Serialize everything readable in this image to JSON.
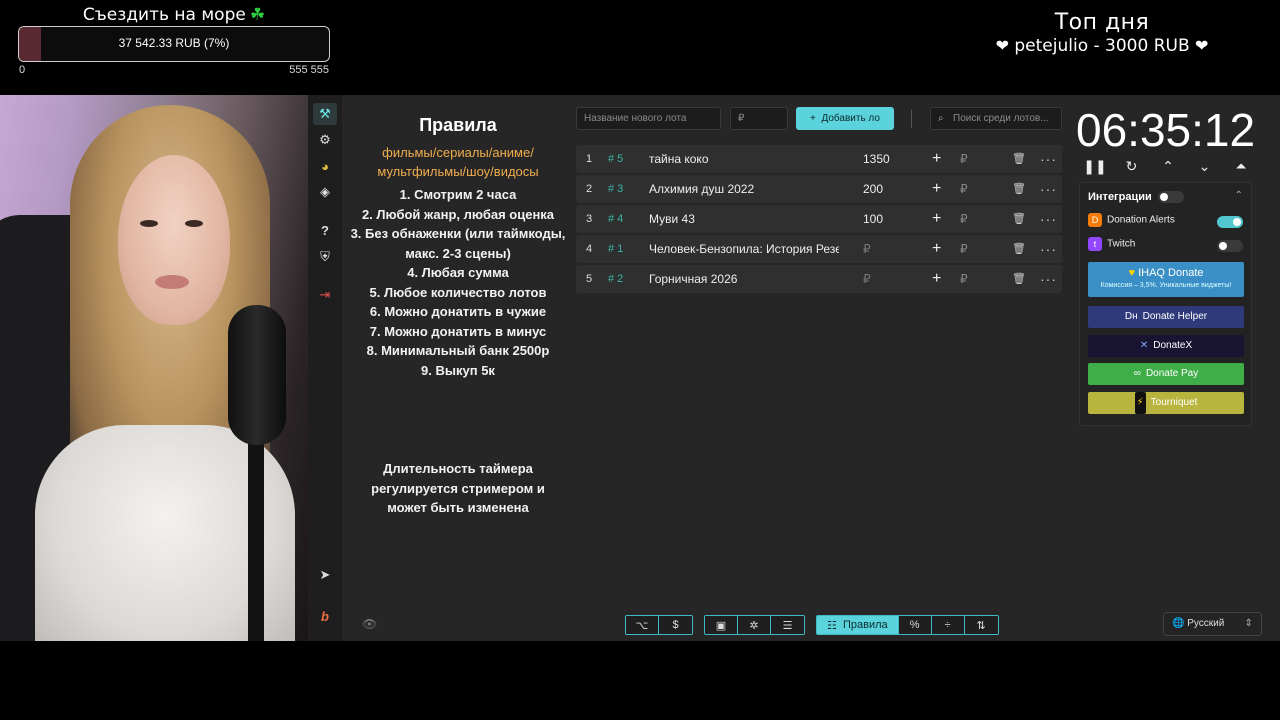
{
  "overlay": {
    "goal": {
      "title": "Съездить на море",
      "clover_icon": "☘",
      "amount_text": "37 542.33 RUB (7%)",
      "progress_fraction": 0.07,
      "min_label": "0",
      "max_label": "555 555"
    },
    "top_day": {
      "title": "Топ дня",
      "entry": "petejulio - 3000 RUB",
      "heart": "❤"
    }
  },
  "sidebar": {
    "items": [
      {
        "icon": "hammer-icon",
        "glyph": "⚒",
        "active": true
      },
      {
        "icon": "gear-icon",
        "glyph": "⚙"
      },
      {
        "icon": "pie-chart-icon",
        "glyph": "◕"
      },
      {
        "icon": "layers-icon",
        "glyph": "◈"
      },
      {
        "icon": "help-icon",
        "glyph": "?"
      },
      {
        "icon": "shield-icon",
        "glyph": "⛨"
      },
      {
        "icon": "logout-icon",
        "glyph": "⇥"
      },
      {
        "icon": "telegram-icon",
        "glyph": "➤"
      },
      {
        "icon": "boosty-icon",
        "glyph": "b"
      }
    ]
  },
  "rules": {
    "title": "Правила",
    "genres": "фильмы/сериалы/аниме/ мультфильмы/шоу/видосы",
    "items": [
      "1. Смотрим 2 часа",
      "2. Любой жанр, любая оценка",
      "3. Без обнаженки (или таймкоды, макс. 2-3 сцены)",
      "4. Любая сумма",
      "5. Любое количество лотов",
      "6. Можно донатить в чужие",
      "7. Можно донатить в минус",
      "8. Минимальный банк 2500р",
      "9. Выкуп 5к"
    ],
    "timer_note": "Длительность таймера регулируется стримером и может быть изменена"
  },
  "toolbar": {
    "new_lot_placeholder": "Название нового лота",
    "amount_placeholder": "₽",
    "add_button": "Добавить ло",
    "search_placeholder": "Поиск среди лотов..."
  },
  "lots": [
    {
      "index": "1",
      "tag": "# 5",
      "name": "тайна коко",
      "amount": "1350"
    },
    {
      "index": "2",
      "tag": "# 3",
      "name": "Алхимия душ 2022",
      "amount": "200"
    },
    {
      "index": "3",
      "tag": "# 4",
      "name": "Муви 43",
      "amount": "100"
    },
    {
      "index": "4",
      "tag": "# 1",
      "name": "Человек-Бензопила: История Резе",
      "amount": "₽"
    },
    {
      "index": "5",
      "tag": "# 2",
      "name": "Горничная 2026",
      "amount": "₽"
    }
  ],
  "lot_row": {
    "plus": "+",
    "currency": "₽",
    "more": "···"
  },
  "timer": {
    "display": "06:35:12"
  },
  "integrations": {
    "title": "Интеграции",
    "services": [
      {
        "name": "Donation Alerts",
        "enabled": true,
        "color": "#f57d07"
      },
      {
        "name": "Twitch",
        "enabled": false,
        "color": "#9146ff"
      }
    ],
    "ihaq": {
      "title": "IHAQ Donate",
      "subtitle": "Комиссия – 3,5%. Уникальные виджеты!",
      "color": "#3a8fc6"
    },
    "providers": [
      {
        "label": "Donate Helper",
        "color": "#2e3a7a"
      },
      {
        "label": "DonateX",
        "color": "#1a1433"
      },
      {
        "label": "Donate Pay",
        "color": "#3fae49"
      },
      {
        "label": "Tourniquet",
        "color": "#b8b43d"
      }
    ]
  },
  "bottom_bar": {
    "rules_tab": "Правила",
    "language": "Русский"
  }
}
